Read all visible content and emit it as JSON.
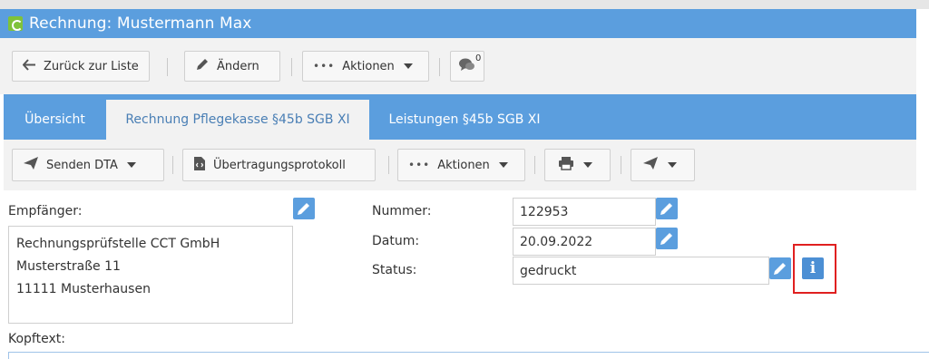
{
  "window": {
    "title": "Rechnung: Mustermann Max"
  },
  "toolbar": {
    "back_label": "Zurück zur Liste",
    "edit_label": "Ändern",
    "actions_label": "Aktionen",
    "comments_count": "0"
  },
  "tabs": [
    {
      "label": "Übersicht"
    },
    {
      "label": "Rechnung Pflegekasse §45b SGB XI"
    },
    {
      "label": "Leistungen §45b SGB XI"
    }
  ],
  "subtoolbar": {
    "send_label": "Senden DTA",
    "protocol_label": "Übertragungsprotokoll",
    "actions_label": "Aktionen"
  },
  "form": {
    "recipient_label": "Empfänger:",
    "recipient_lines": [
      "Rechnungsprüfstelle CCT GmbH",
      "Musterstraße 11",
      "11111 Musterhausen"
    ],
    "number_label": "Nummer:",
    "number_value": "122953",
    "date_label": "Datum:",
    "date_value": "20.09.2022",
    "status_label": "Status:",
    "status_value": "gedruckt",
    "header_text_label": "Kopftext:"
  },
  "colors": {
    "accent": "#5b9ede",
    "highlight": "#e02020",
    "active_tab_text": "#4a7fb5"
  }
}
